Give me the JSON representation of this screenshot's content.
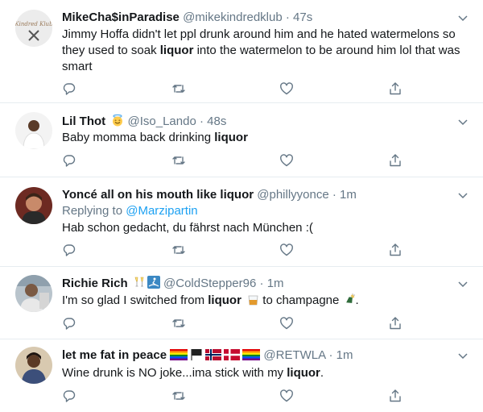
{
  "tweets": [
    {
      "name": "MikeCha$inParadise",
      "handle": "@mikekindredklub",
      "time": "47s",
      "text_parts": [
        "Jimmy Hoffa didn't let ppl drunk around him and he hated watermelons so they used to soak ",
        "liquor",
        " into the watermelon to be around him lol that was smart"
      ]
    },
    {
      "name": "Lil Thot",
      "handle": "@Iso_Lando",
      "time": "48s",
      "text_parts": [
        "Baby momma back drinking ",
        "liquor"
      ]
    },
    {
      "name": "Yoncé all on his mouth like liquor",
      "handle": "@phillyyonce",
      "time": "1m",
      "reply_label": "Replying to ",
      "reply_handle": "@Marzipartin",
      "text_parts": [
        "Hab schon gedacht, du fährst nach München :("
      ]
    },
    {
      "name": "Richie Rich",
      "handle": "@ColdStepper96",
      "time": "1m",
      "text_parts": [
        "I'm so glad I switched from ",
        "liquor",
        " to champagne ",
        "."
      ]
    },
    {
      "name": "let me fat in peace",
      "handle": "@RETWLA",
      "time": "1m",
      "text_parts": [
        "Wine drunk is NO joke...ima stick with my ",
        "liquor",
        "."
      ]
    }
  ],
  "separator": "·",
  "icons": {
    "reply": "reply-icon",
    "retweet": "retweet-icon",
    "like": "heart-icon",
    "share": "share-icon",
    "more": "chevron-down-icon"
  },
  "colors": {
    "name": "#14171a",
    "meta": "#657786",
    "link": "#1da1f2",
    "border": "#e6ecf0"
  }
}
